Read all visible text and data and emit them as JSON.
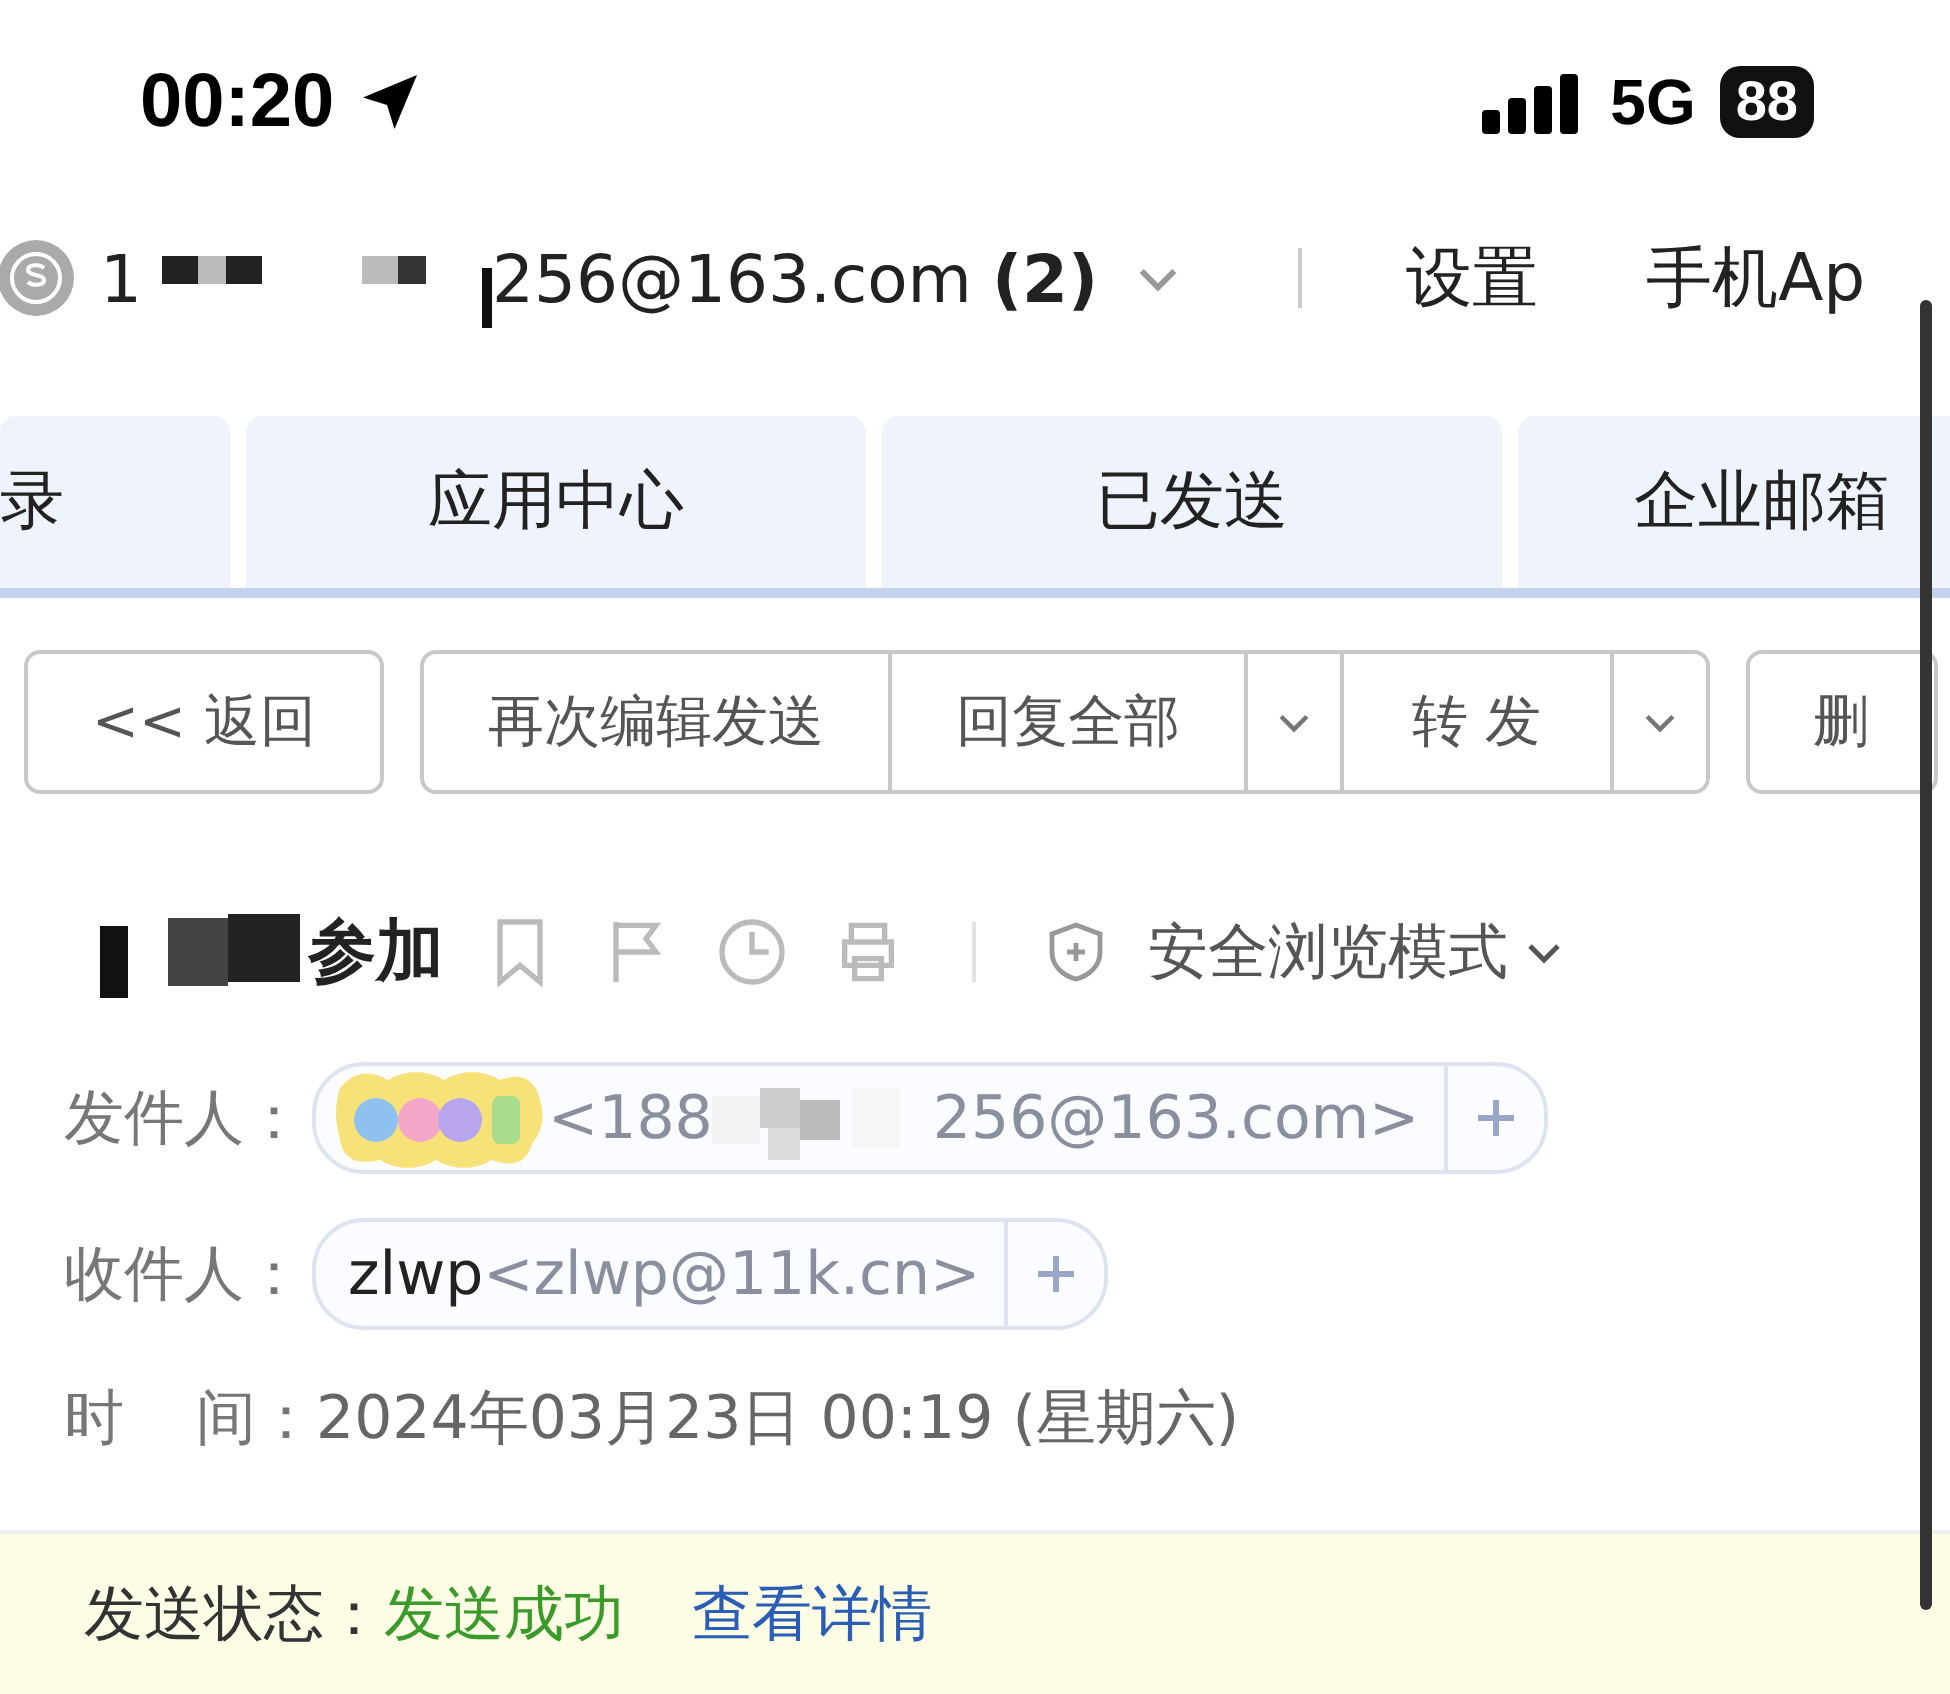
{
  "status_bar": {
    "time": "00:20",
    "network": "5G",
    "battery": "88"
  },
  "account": {
    "prefix": "1",
    "address_tail": "256@163.com",
    "unread": "(2)"
  },
  "top_links": [
    "设置",
    "手机Ap"
  ],
  "tabs": [
    {
      "label": "录",
      "selected": false
    },
    {
      "label": "应用中心",
      "selected": false
    },
    {
      "label": "已发送",
      "selected": false
    },
    {
      "label": "企业邮箱",
      "selected": false
    }
  ],
  "toolbar": [
    {
      "label": "<< 返回",
      "kind": "single"
    },
    {
      "label": "再次编辑发送",
      "kind": "grouped"
    },
    {
      "label": "回复全部",
      "kind": "grouped-split"
    },
    {
      "label": "转 发",
      "kind": "grouped-split"
    },
    {
      "label": "删",
      "kind": "single"
    }
  ],
  "subject": {
    "text": "参加",
    "mode": "安全浏览模式"
  },
  "sender": {
    "label": "发件人：",
    "address_head": "<188",
    "address_tail": "256@163.com>"
  },
  "recipient": {
    "label": "收件人：",
    "name": "zlwp",
    "address": "<zlwp@11k.cn>"
  },
  "time": {
    "label_1": "时",
    "label_2": "间：",
    "value": "2024年03月23日 00:19 (星期六)"
  },
  "send_status": {
    "label": "发送状态：",
    "value": "发送成功",
    "link": "查看详情"
  }
}
